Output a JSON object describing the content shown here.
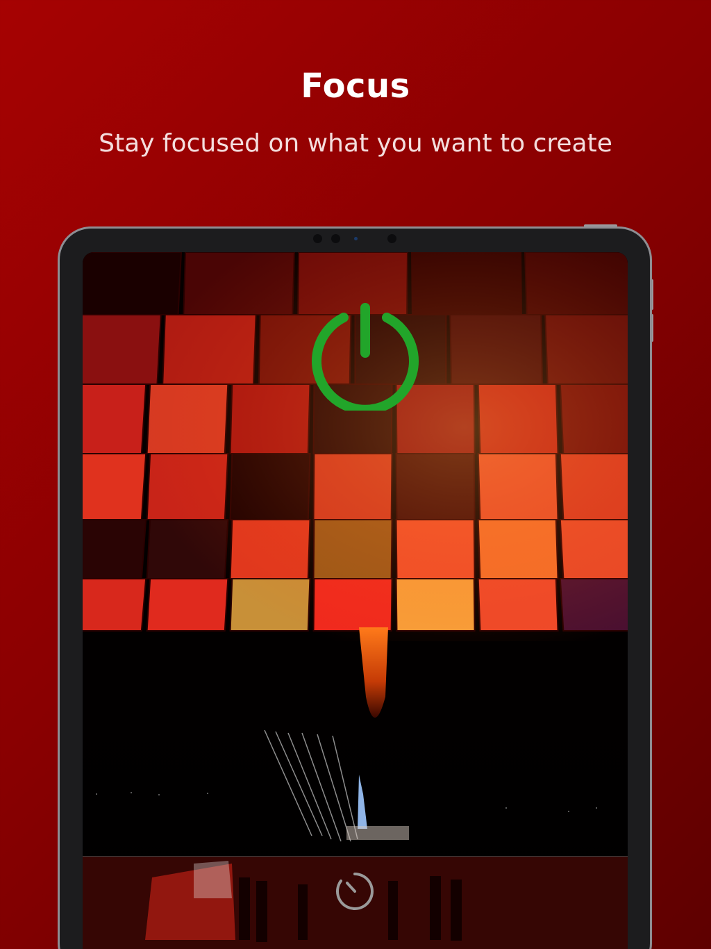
{
  "header": {
    "title": "Focus",
    "subtitle": "Stay focused on what you want to create"
  },
  "colors": {
    "background_start": "#a60202",
    "background_end": "#5e0000",
    "power_icon": "#22a52a",
    "timer_icon": "#9a9a9a",
    "device_frame": "#1c1c1e"
  },
  "screen": {
    "background_image": "hot-air-balloon-night",
    "controls": {
      "power_icon": "power-icon",
      "timer_icon": "timer-icon"
    }
  }
}
